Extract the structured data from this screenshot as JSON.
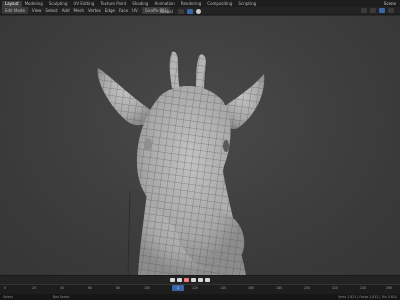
{
  "topbar": {
    "tabs": [
      "Layout",
      "Modeling",
      "Sculpting",
      "UV Editing",
      "Texture Paint",
      "Shading",
      "Animation",
      "Rendering",
      "Compositing",
      "Scripting"
    ],
    "active_tab": 0,
    "scene_label": "Scene"
  },
  "toolbar": {
    "mode_label": "Edit Mode",
    "menu_items": [
      "View",
      "Select",
      "Add",
      "Mesh",
      "Vertex",
      "Edge",
      "Face",
      "UV"
    ],
    "object_label": "Giraffe.001",
    "orientation_label": "Global"
  },
  "timeline": {
    "ticks": [
      "0",
      "20",
      "40",
      "60",
      "80",
      "100",
      "120",
      "140",
      "160",
      "180",
      "200",
      "220",
      "240",
      "260"
    ],
    "current_frame": "1"
  },
  "status": {
    "left": "Select",
    "middle": "Box Select",
    "right": "Verts 2,821 | Faces 2,812 | Tris 5,624"
  },
  "colors": {
    "accent": "#3a66a8",
    "header_bg": "#1d1d1d",
    "viewport_bg": "#3d3d3d",
    "mesh_fill": "#a9a9a9",
    "wire": "#4a4a4a"
  }
}
